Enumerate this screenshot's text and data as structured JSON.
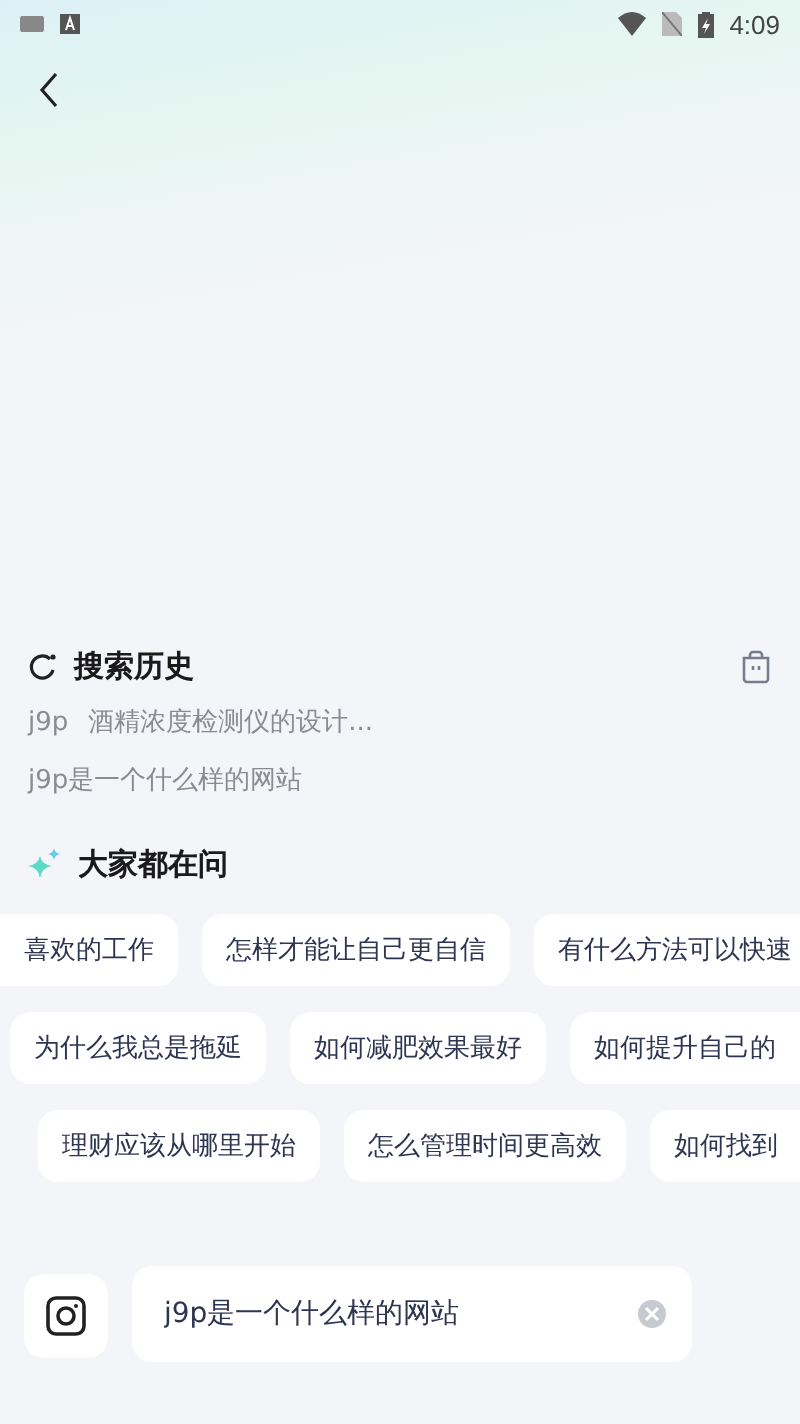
{
  "status_bar": {
    "time": "4:09"
  },
  "history": {
    "title": "搜索历史",
    "items": [
      {
        "tag": "j9p",
        "text": "酒精浓度检测仪的设计..."
      },
      {
        "text": "j9p是一个什么样的网站"
      }
    ]
  },
  "popular": {
    "title": "大家都在问",
    "rows": [
      [
        "喜欢的工作",
        "怎样才能让自己更自信",
        "有什么方法可以快速"
      ],
      [
        "为什么我总是拖延",
        "如何减肥效果最好",
        "如何提升自己的"
      ],
      [
        "理财应该从哪里开始",
        "怎么管理时间更高效",
        "如何找到"
      ]
    ]
  },
  "search": {
    "value": "j9p是一个什么样的网站"
  }
}
